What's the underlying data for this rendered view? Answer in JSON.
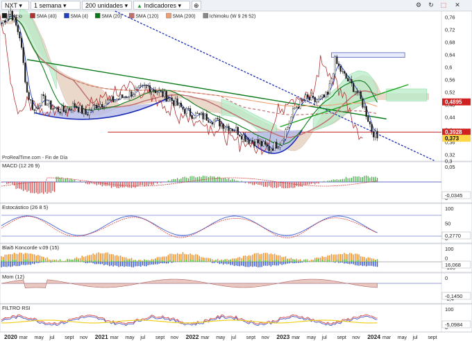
{
  "toolbar": {
    "ticker": "NXT",
    "period": "1 semana",
    "units": "200 unidades",
    "indicators": "Indicadores",
    "icons": [
      "gear-icon",
      "refresh-icon",
      "popout-icon",
      "close-icon"
    ]
  },
  "colors": {
    "price": "#1a1a1a",
    "sma4": "#2040c0",
    "sma20": "#0a7a18",
    "sma120": "#c07070",
    "sma200": "#f0a070",
    "ichimoku_red": "#b03030",
    "cloud_tan": "#d8b8a0",
    "cloud_green": "#b8ecc8",
    "trend_blue": "#1a2bb8",
    "support_red": "#c02020",
    "green_trend": "#19a319",
    "macd_green": "#3fa63f",
    "macd_red": "#d04040"
  },
  "watermark": "ProRealTime.com - Fin de Día",
  "main": {
    "legend": [
      {
        "label": "Precio",
        "color": "#1a1a1a"
      },
      {
        "label": "SMA (40)",
        "color": "#b03030"
      },
      {
        "label": "SMA (4)",
        "color": "#2040c0"
      },
      {
        "label": "SMA (20)",
        "color": "#0a7a18"
      },
      {
        "label": "SMA (120)",
        "color": "#c07070"
      },
      {
        "label": "SMA (200)",
        "color": "#f0a070"
      },
      {
        "label": "Ichimoku (W 9 26 52)",
        "color": "#888"
      }
    ],
    "yticks": [
      "0,76",
      "0,72",
      "0,68",
      "0,64",
      "0,6",
      "0,56",
      "0,52",
      "0,48",
      "0,44",
      "0,4",
      "0,36",
      "0,32",
      "0,3"
    ],
    "badges": [
      {
        "text": "0,4895",
        "value": 0.4895,
        "color": "#d02020"
      },
      {
        "text": "0,3928",
        "value": 0.3928,
        "color": "#d02020"
      },
      {
        "text": "0,373",
        "value": 0.373,
        "color": "#ffd84a"
      }
    ]
  },
  "panels": [
    {
      "title": "MACD (12 26 9)",
      "yticks": [
        "0,05",
        "0"
      ],
      "badges": [
        "-0,0345"
      ]
    },
    {
      "title": "Estocástico (26 8 5)",
      "yticks": [
        "100",
        "50",
        "0"
      ],
      "badges": [
        "0,2770"
      ]
    },
    {
      "title": "Blai5 Koncorde v.09 (15)",
      "yticks": [
        "100",
        "0",
        "-100"
      ],
      "badges": [
        "16,068"
      ]
    },
    {
      "title": "Mom (12)",
      "yticks": [
        "0",
        "-0,4"
      ],
      "badges": [
        "-0,1450"
      ]
    },
    {
      "title": "FILTRO RSI",
      "yticks": [
        "100",
        "0"
      ],
      "badges": [
        "-5,0984"
      ]
    }
  ],
  "xaxis": [
    "2020",
    "mar",
    "may",
    "jul",
    "sept",
    "nov",
    "2021",
    "mar",
    "may",
    "jul",
    "sept",
    "nov",
    "2022",
    "mar",
    "may",
    "jul",
    "sept",
    "nov",
    "2023",
    "mar",
    "may",
    "jul",
    "sept",
    "nov",
    "2024",
    "mar",
    "may",
    "jul",
    "sept"
  ],
  "chart_data": {
    "type": "line",
    "title": "NXT",
    "x": [
      "2020-01",
      "2020-03",
      "2020-05",
      "2020-07",
      "2020-09",
      "2020-11",
      "2021-01",
      "2021-03",
      "2021-05",
      "2021-07",
      "2021-09",
      "2021-11",
      "2022-01",
      "2022-03",
      "2022-05",
      "2022-07",
      "2022-09",
      "2022-11",
      "2023-01",
      "2023-03",
      "2023-05",
      "2023-07",
      "2023-09",
      "2023-11"
    ],
    "series": [
      {
        "name": "Precio",
        "values": [
          0.74,
          0.46,
          0.48,
          0.46,
          0.45,
          0.45,
          0.47,
          0.48,
          0.5,
          0.52,
          0.5,
          0.46,
          0.43,
          0.42,
          0.4,
          0.36,
          0.37,
          0.36,
          0.48,
          0.5,
          0.51,
          0.58,
          0.48,
          0.37
        ]
      },
      {
        "name": "SMA (40)",
        "values": [
          0.72,
          0.62,
          0.54,
          0.5,
          0.48,
          0.47,
          0.47,
          0.47,
          0.48,
          0.49,
          0.5,
          0.49,
          0.47,
          0.45,
          0.43,
          0.41,
          0.39,
          0.39,
          0.42,
          0.46,
          0.48,
          0.51,
          0.5,
          0.45
        ]
      }
    ],
    "ylim": [
      0.3,
      0.78
    ]
  }
}
